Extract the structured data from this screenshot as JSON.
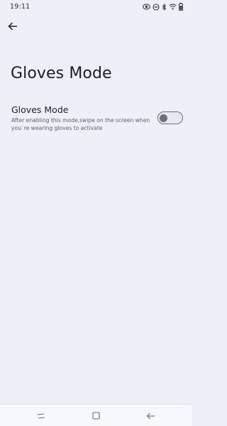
{
  "status_bar": {
    "time": "19:11",
    "icons": [
      "eye-comfort-icon",
      "do-not-disturb-icon",
      "bluetooth-icon",
      "wifi-icon",
      "battery-icon"
    ]
  },
  "header": {
    "back_icon": "arrow-back-icon"
  },
  "page": {
    "title": "Gloves Mode"
  },
  "setting": {
    "title": "Gloves Mode",
    "description": "After enabling this mode,swipe on the screen when you`re wearing gloves to activate",
    "enabled": false
  },
  "nav_bar": {
    "buttons": [
      "recents-icon",
      "home-icon",
      "back-icon"
    ]
  },
  "colors": {
    "background": "#eef0f7",
    "toggle_off": "#6d7078"
  }
}
